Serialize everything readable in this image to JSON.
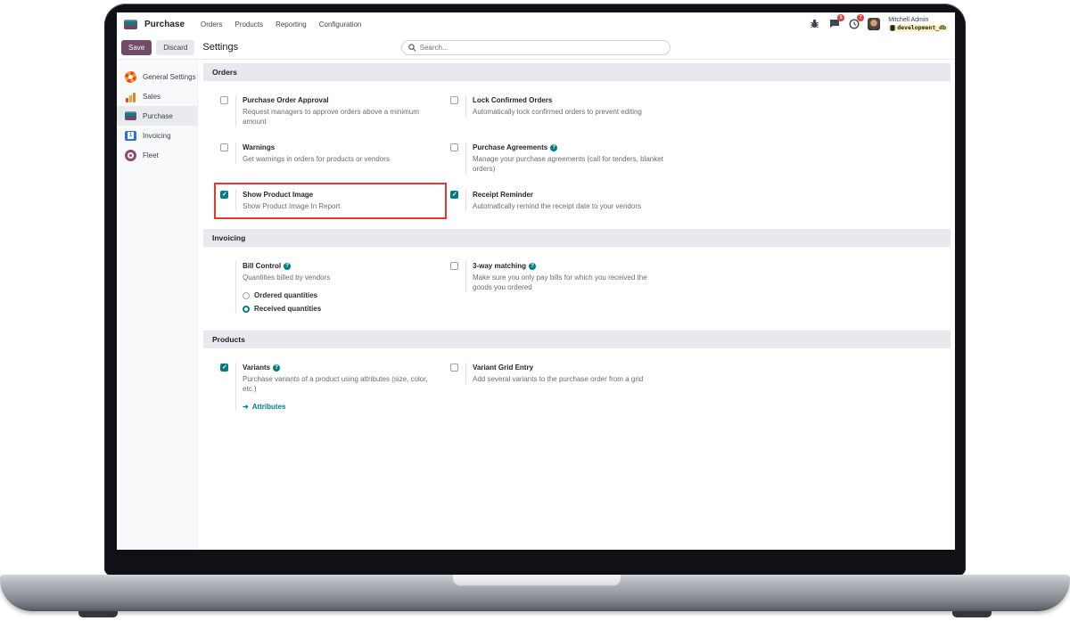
{
  "app": {
    "name": "Purchase",
    "menus": [
      {
        "label": "Orders"
      },
      {
        "label": "Products"
      },
      {
        "label": "Reporting"
      },
      {
        "label": "Configuration"
      }
    ]
  },
  "systray": {
    "messages_badge": "5",
    "activities_badge": "7",
    "user_name": "Mitchell Admin",
    "database": "development_db"
  },
  "control_bar": {
    "save_label": "Save",
    "discard_label": "Discard",
    "breadcrumb": "Settings",
    "search_placeholder": "Search..."
  },
  "sidebar": {
    "items": [
      {
        "label": "General Settings"
      },
      {
        "label": "Sales"
      },
      {
        "label": "Purchase"
      },
      {
        "label": "Invoicing"
      },
      {
        "label": "Fleet"
      }
    ]
  },
  "settings": {
    "orders": {
      "title": "Orders",
      "items": [
        {
          "label": "Purchase Order Approval",
          "desc": "Request managers to approve orders above a minimum amount",
          "checked": false
        },
        {
          "label": "Lock Confirmed Orders",
          "desc": "Automatically lock confirmed orders to prevent editing",
          "checked": false
        },
        {
          "label": "Warnings",
          "desc": "Get warnings in orders for products or vendors",
          "checked": false
        },
        {
          "label": "Purchase Agreements",
          "desc": "Manage your purchase agreements (call for tenders, blanket orders)",
          "checked": false
        },
        {
          "label": "Show Product Image",
          "desc": "Show Product Image In Report",
          "checked": true
        },
        {
          "label": "Receipt Reminder",
          "desc": "Automatically remind the receipt date to your vendors",
          "checked": true
        }
      ]
    },
    "invoicing": {
      "title": "Invoicing",
      "bill_control": {
        "label": "Bill Control",
        "desc": "Quantities billed by vendors",
        "options": [
          {
            "label": "Ordered quantities",
            "selected": false
          },
          {
            "label": "Received quantities",
            "selected": true
          }
        ]
      },
      "three_way": {
        "label": "3-way matching",
        "desc": "Make sure you only pay bills for which you received the goods you ordered",
        "checked": false
      }
    },
    "products": {
      "title": "Products",
      "variants": {
        "label": "Variants",
        "desc": "Purchase variants of a product using attributes (size, color, etc.)",
        "checked": true,
        "link": "Attributes"
      },
      "grid_entry": {
        "label": "Variant Grid Entry",
        "desc": "Add several variants to the purchase order from a grid",
        "checked": false
      }
    }
  },
  "icons": {
    "help": "?",
    "arrow": "➜"
  }
}
